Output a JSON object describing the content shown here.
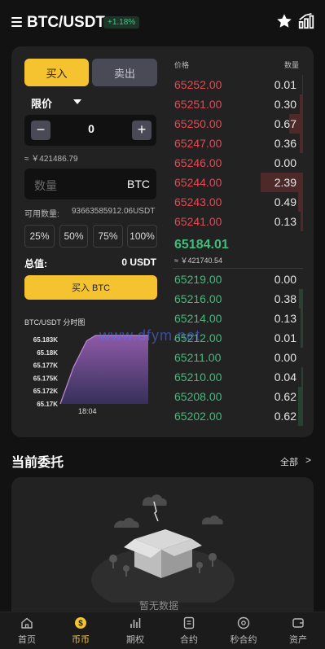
{
  "header": {
    "pair": "BTC/USDT",
    "change": "+1.18%",
    "icons": [
      "menu-icon",
      "star-icon",
      "kline-chart-icon"
    ]
  },
  "trade": {
    "buy_tab": "买入",
    "sell_tab": "卖出",
    "order_type": "限价",
    "price_value": "0",
    "minus": "−",
    "plus": "+",
    "approx_value": "≈ ￥421486.79",
    "qty_placeholder": "数量",
    "qty_unit": "BTC",
    "available_label": "可用数量:",
    "available_value": "93663585912.06USDT",
    "percents": [
      "25%",
      "50%",
      "75%",
      "100%"
    ],
    "total_label": "总值:",
    "total_value": "0 USDT",
    "buy_button": "买入 BTC",
    "mini_chart_title": "BTC/USDT 分时图"
  },
  "mini_chart": {
    "chart_data": {
      "type": "area",
      "title": "BTC/USDT 分时图",
      "x_tick": "18:04",
      "y_ticks": [
        "65.183K",
        "65.18K",
        "65.177K",
        "65.175K",
        "65.172K",
        "65.17K"
      ],
      "points": [
        [
          0,
          65.17
        ],
        [
          0.15,
          65.177
        ],
        [
          0.3,
          65.182
        ],
        [
          0.4,
          65.183
        ],
        [
          1.0,
          65.183
        ]
      ]
    }
  },
  "orderbook": {
    "header_price": "价格",
    "header_qty": "数量",
    "asks": [
      {
        "price": "65252.00",
        "qty": "0.01",
        "depth": 0.02
      },
      {
        "price": "65251.00",
        "qty": "0.30",
        "depth": 0.08
      },
      {
        "price": "65250.00",
        "qty": "0.67",
        "depth": 0.32
      },
      {
        "price": "65247.00",
        "qty": "0.36",
        "depth": 0.08
      },
      {
        "price": "65246.00",
        "qty": "0.00",
        "depth": 0.0
      },
      {
        "price": "65244.00",
        "qty": "2.39",
        "depth": 1.0
      },
      {
        "price": "65243.00",
        "qty": "0.49",
        "depth": 0.12
      },
      {
        "price": "65241.00",
        "qty": "0.13",
        "depth": 0.05
      }
    ],
    "mid_price": "65184.01",
    "mid_approx": "≈ ￥421740.54",
    "bids": [
      {
        "price": "65219.00",
        "qty": "0.00",
        "depth": 0.0
      },
      {
        "price": "65216.00",
        "qty": "0.38",
        "depth": 0.1
      },
      {
        "price": "65214.00",
        "qty": "0.13",
        "depth": 0.05
      },
      {
        "price": "65212.00",
        "qty": "0.01",
        "depth": 0.05
      },
      {
        "price": "65211.00",
        "qty": "0.00",
        "depth": 0.0
      },
      {
        "price": "65210.00",
        "qty": "0.04",
        "depth": 0.03
      },
      {
        "price": "65208.00",
        "qty": "0.62",
        "depth": 0.12
      },
      {
        "price": "65202.00",
        "qty": "0.62",
        "depth": 0.12
      }
    ]
  },
  "orders": {
    "title": "当前委托",
    "all": "全部",
    "empty_text": "暂无数据"
  },
  "watermark": "www.dfym.net",
  "nav": [
    {
      "label": "首页",
      "icon": "home-icon",
      "active": false
    },
    {
      "label": "币币",
      "icon": "coin-icon",
      "active": true
    },
    {
      "label": "期权",
      "icon": "options-icon",
      "active": false
    },
    {
      "label": "合约",
      "icon": "contract-icon",
      "active": false
    },
    {
      "label": "秒合约",
      "icon": "second-contract-icon",
      "active": false
    },
    {
      "label": "资产",
      "icon": "wallet-icon",
      "active": false
    }
  ],
  "colors": {
    "accent": "#f5c330",
    "ask": "#e04a55",
    "bid": "#3fbd7b",
    "background": "#121212",
    "card": "#222222"
  }
}
